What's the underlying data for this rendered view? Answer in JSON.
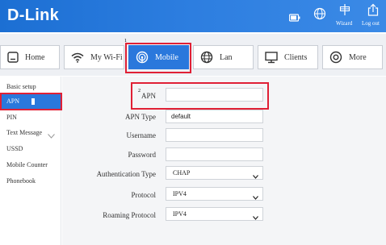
{
  "header": {
    "logo": "D-Link",
    "wizard_label": "Wizard",
    "logout_label": "Log out",
    "icons": [
      "battery-icon",
      "globe-icon",
      "wizard-icon",
      "logout-icon"
    ]
  },
  "tabs": [
    {
      "label": "Home",
      "icon": "home-icon"
    },
    {
      "label": "My Wi-Fi",
      "icon": "wifi-icon"
    },
    {
      "label": "Mobile",
      "icon": "mobile-signal-icon",
      "active": true
    },
    {
      "label": "Lan",
      "icon": "globe-icon"
    },
    {
      "label": "Clients",
      "icon": "monitor-icon"
    },
    {
      "label": "More",
      "icon": "more-icon"
    }
  ],
  "markers": {
    "tab_marker": "1",
    "apn_marker": "2"
  },
  "sidebar": {
    "items": [
      {
        "label": "Basic setup"
      },
      {
        "label": "APN",
        "active": true
      },
      {
        "label": "PIN"
      },
      {
        "label": "Text Message",
        "expandable": true
      },
      {
        "label": "USSD"
      },
      {
        "label": "Mobile Counter"
      },
      {
        "label": "Phonebook"
      }
    ]
  },
  "form": {
    "apn": {
      "label": "APN",
      "value": ""
    },
    "apn_type": {
      "label": "APN Type",
      "value": "default"
    },
    "username": {
      "label": "Username",
      "value": ""
    },
    "password": {
      "label": "Password",
      "value": ""
    },
    "auth_type": {
      "label": "Authentication Type",
      "value": "CHAP"
    },
    "protocol": {
      "label": "Protocol",
      "value": "IPV4"
    },
    "roaming_protocol": {
      "label": "Roaming Protocol",
      "value": "IPV4"
    }
  },
  "colors": {
    "header_blue": "#2a78dc",
    "active_tab": "#2a78dc",
    "highlight_red": "#e02035"
  }
}
